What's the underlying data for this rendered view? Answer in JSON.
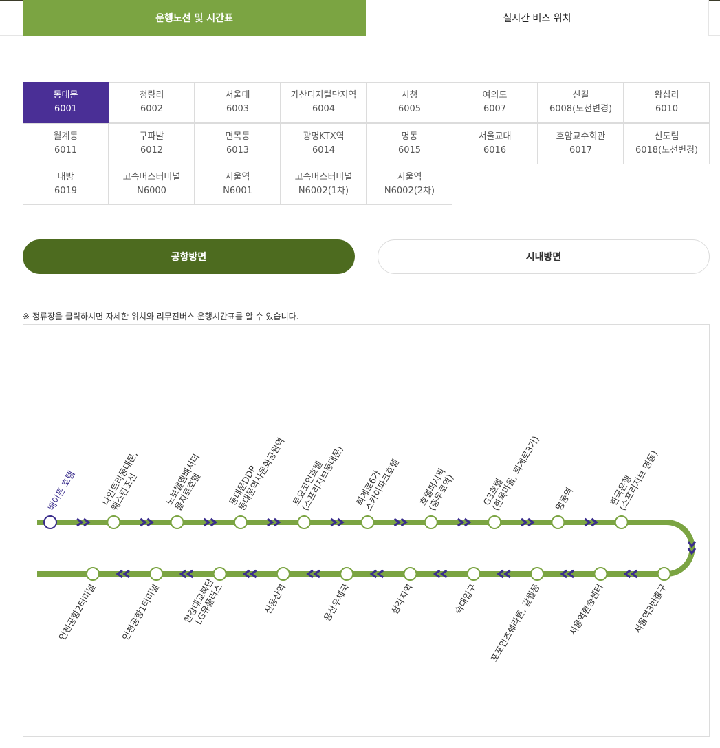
{
  "tabs": {
    "schedule": "운행노선 및 시간표",
    "realtime": "실시간 버스 위치"
  },
  "routes": [
    {
      "name": "동대문",
      "code": "6001",
      "active": true
    },
    {
      "name": "청량리",
      "code": "6002"
    },
    {
      "name": "서울대",
      "code": "6003"
    },
    {
      "name": "가산디지털단지역",
      "code": "6004"
    },
    {
      "name": "시청",
      "code": "6005"
    },
    {
      "name": "여의도",
      "code": "6007"
    },
    {
      "name": "신길",
      "code": "6008(노선변경)"
    },
    {
      "name": "왕십리",
      "code": "6010"
    },
    {
      "name": "월계동",
      "code": "6011"
    },
    {
      "name": "구파발",
      "code": "6012"
    },
    {
      "name": "면목동",
      "code": "6013"
    },
    {
      "name": "광명KTX역",
      "code": "6014"
    },
    {
      "name": "명동",
      "code": "6015"
    },
    {
      "name": "서울교대",
      "code": "6016"
    },
    {
      "name": "호암교수회관",
      "code": "6017"
    },
    {
      "name": "신도림",
      "code": "6018(노선변경)"
    },
    {
      "name": "내방",
      "code": "6019"
    },
    {
      "name": "고속버스터미널",
      "code": "N6000"
    },
    {
      "name": "서울역",
      "code": "N6001"
    },
    {
      "name": "고속버스터미널",
      "code": "N6002(1차)"
    },
    {
      "name": "서울역",
      "code": "N6002(2차)"
    }
  ],
  "directions": {
    "airport": "공항방면",
    "city": "시내방면"
  },
  "note": "※ 정류장을 클릭하시면 자세한 위치와 리무진버스 운행시간표를 알 수 있습니다.",
  "colors": {
    "accent_green": "#7ba442",
    "dark_green": "#4d6b1f",
    "active_route": "#4a2f96",
    "arrow": "#3a2d8c"
  },
  "stops_top": [
    [
      "베이튼 호텔"
    ],
    [
      "나인트리동대문,",
      "웨스틴조선"
    ],
    [
      "노보텔앰배서더",
      "을지로호텔"
    ],
    [
      "동대문DDP",
      "동대문역사문화공원역"
    ],
    [
      "토요코인호텔",
      "(스프리지브동대문)"
    ],
    [
      "퇴계로6가",
      "스카이파크호텔"
    ],
    [
      "호텔퍼시픽",
      "(충무로역)"
    ],
    [
      "G3호텔",
      "(한옥마을, 퇴계로3가)"
    ],
    [
      "명동역"
    ],
    [
      "한국은행",
      "(스프리지브 명동)"
    ]
  ],
  "stops_bottom": [
    [
      "인천공항2터미널"
    ],
    [
      "인천공항1터미널"
    ],
    [
      "한강대교북단",
      "LG유플러스"
    ],
    [
      "신용산역"
    ],
    [
      "용산우체국"
    ],
    [
      "삼각지역"
    ],
    [
      "숙대입구"
    ],
    [
      "포포인츠쉐라톤, 갈월동"
    ],
    [
      "서울역환승센터"
    ],
    [
      "서울역3번출구"
    ]
  ]
}
